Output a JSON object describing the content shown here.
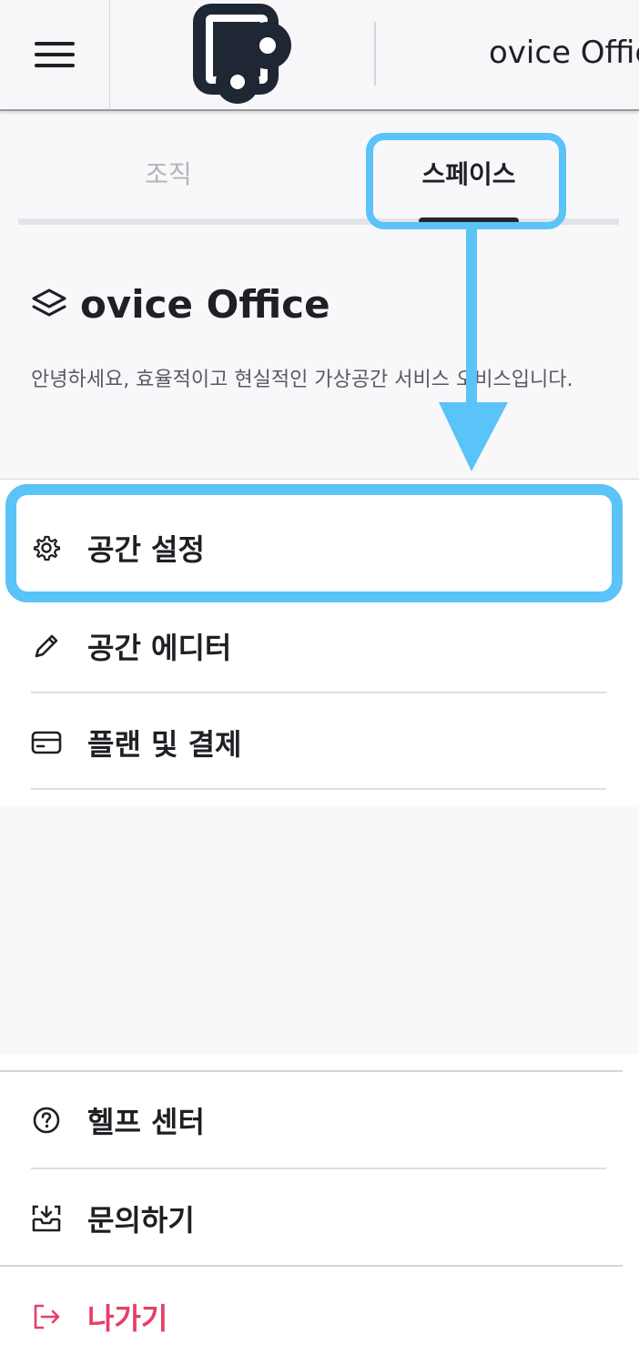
{
  "header": {
    "menu_icon": "hamburger-menu-icon",
    "logo_icon": "ovice-logo-icon",
    "title": "ovice Offic"
  },
  "tabs": [
    {
      "label": "조직",
      "active": false
    },
    {
      "label": "스페이스",
      "active": true
    }
  ],
  "space": {
    "icon": "layers-icon",
    "name": "ovice Office",
    "description": "안녕하세요, 효율적이고 현실적인 가상공간 서비스 오비스입니다."
  },
  "settings_menu": [
    {
      "label": "공간 설정",
      "icon": "gear-icon"
    },
    {
      "label": "공간 에디터",
      "icon": "pencil-icon"
    },
    {
      "label": "플랜 및 결제",
      "icon": "credit-card-icon"
    }
  ],
  "bottom_menu": [
    {
      "label": "헬프 센터",
      "icon": "help-circle-icon"
    },
    {
      "label": "문의하기",
      "icon": "inbox-download-icon"
    },
    {
      "label": "나가기",
      "icon": "logout-icon"
    }
  ],
  "colors": {
    "highlight": "#5ac3f7",
    "exit": "#e53e66",
    "text": "#1f1f24",
    "muted_tab": "#b4b4b8"
  }
}
